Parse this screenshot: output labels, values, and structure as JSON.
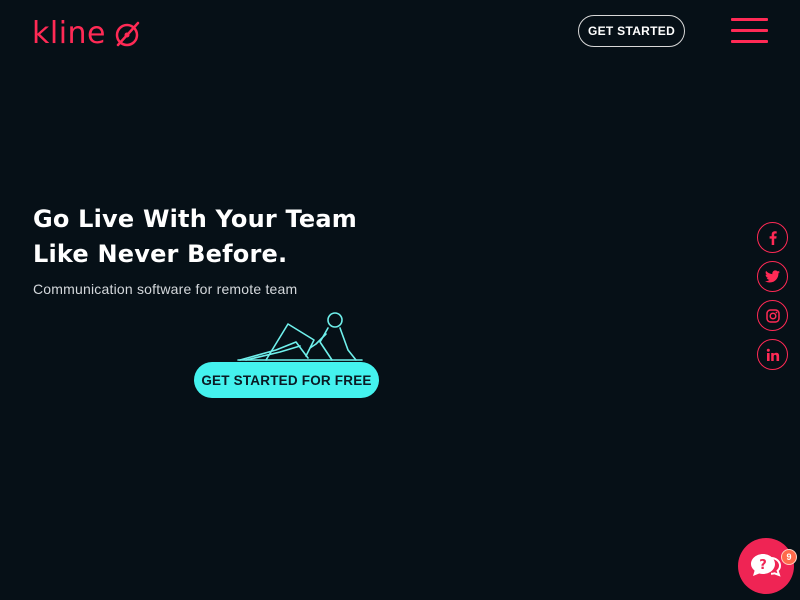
{
  "header": {
    "logo_text": "kline",
    "cta_label": "GET STARTED"
  },
  "hero": {
    "title_line1": "Go Live With Your Team",
    "title_line2": "Like Never Before.",
    "subtitle": "Communication software for remote team",
    "cta_label": "GET STARTED FOR FREE"
  },
  "social": [
    {
      "name": "facebook-icon",
      "glyph": "f"
    },
    {
      "name": "twitter-icon",
      "glyph": "twitter"
    },
    {
      "name": "instagram-icon",
      "glyph": "instagram"
    },
    {
      "name": "linkedin-icon",
      "glyph": "in"
    }
  ],
  "help_widget": {
    "badge_count": "9"
  },
  "colors": {
    "background": "#061017",
    "accent": "#ff2a55",
    "cta": "#44f2ee"
  }
}
